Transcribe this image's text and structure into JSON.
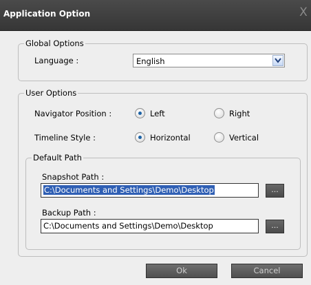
{
  "window": {
    "title": "Application Option",
    "close_glyph": "X"
  },
  "global_options": {
    "legend": "Global Options",
    "language_label": "Language :",
    "language_value": "English"
  },
  "user_options": {
    "legend": "User Options",
    "navigator_label": "Navigator Position :",
    "navigator_options": [
      "Left",
      "Right"
    ],
    "navigator_selected": "Left",
    "timeline_label": "Timeline Style :",
    "timeline_options": [
      "Horizontal",
      "Vertical"
    ],
    "timeline_selected": "Horizontal"
  },
  "default_path": {
    "legend": "Default Path",
    "snapshot_label": "Snapshot Path :",
    "snapshot_value": "C:\\Documents and Settings\\Demo\\Desktop",
    "backup_label": "Backup Path :",
    "backup_value": "C:\\Documents and Settings\\Demo\\Desktop",
    "browse_label": "..."
  },
  "buttons": {
    "ok": "Ok",
    "cancel": "Cancel"
  },
  "colors": {
    "titlebar": "#3e3e3e",
    "selection": "#2f5fb4",
    "radio_dot": "#1c62a5"
  },
  "icons": {
    "dropdown": "chevron-down-icon",
    "close": "close-icon"
  }
}
